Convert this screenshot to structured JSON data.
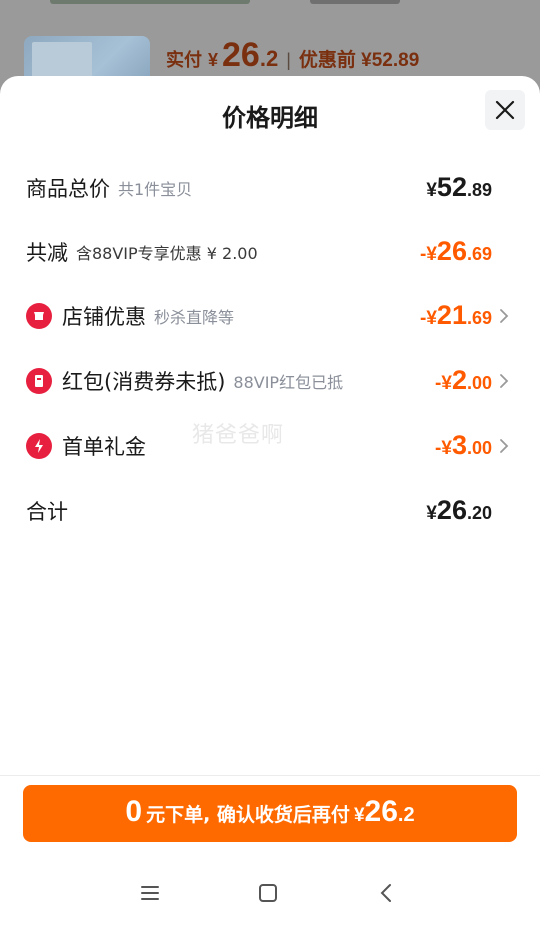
{
  "background": {
    "paid_label": "实付",
    "yen": "¥",
    "paid_int": "26",
    "paid_dec": ".2",
    "separator": "|",
    "original_label": "优惠前 ¥52.89"
  },
  "sheet": {
    "title": "价格明细",
    "close_icon": "close-icon"
  },
  "rows": [
    {
      "title": "商品总价",
      "sub": "共1件宝贝",
      "sign": "¥",
      "int": "52",
      "dec": ".89",
      "color": "black",
      "icon": null,
      "chevron": false
    },
    {
      "title": "共减",
      "sub": "含88VIP专享优惠 ¥ 2.00",
      "sign": "-¥",
      "int": "26",
      "dec": ".69",
      "color": "orange",
      "icon": null,
      "chevron": false
    },
    {
      "title": "店铺优惠",
      "sub": "秒杀直降等",
      "sign": "-¥",
      "int": "21",
      "dec": ".69",
      "color": "orange",
      "icon": "shop-icon",
      "chevron": true
    },
    {
      "title": "红包(消费券未抵)",
      "sub": "88VIP红包已抵",
      "sign": "-¥",
      "int": "2",
      "dec": ".00",
      "color": "orange",
      "icon": "red-packet-icon",
      "chevron": true
    },
    {
      "title": "首单礼金",
      "sub": "",
      "sign": "-¥",
      "int": "3",
      "dec": ".00",
      "color": "orange",
      "icon": "lightning-icon",
      "chevron": true
    },
    {
      "title": "合计",
      "sub": "",
      "sign": "¥",
      "int": "26",
      "dec": ".20",
      "color": "black",
      "icon": null,
      "chevron": false
    }
  ],
  "watermark": "猪爸爸啊",
  "order_button": {
    "zero": "0",
    "text": "元下单, 确认收货后再付",
    "yen": "¥",
    "int": "26",
    "dec": ".2"
  },
  "navbar": {
    "menu": "menu-icon",
    "home": "home-icon",
    "back": "back-icon"
  },
  "colors": {
    "accent_orange": "#ff6a00",
    "discount_orange": "#ff5a00",
    "icon_red": "#e8203f"
  }
}
